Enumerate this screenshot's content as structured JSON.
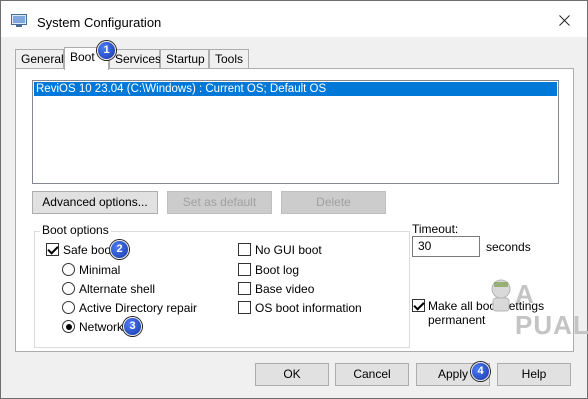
{
  "window": {
    "title": "System Configuration",
    "close_glyph": "✕"
  },
  "tabs": [
    {
      "label": "General",
      "active": false
    },
    {
      "label": "Boot",
      "active": true
    },
    {
      "label": "Services",
      "active": false
    },
    {
      "label": "Startup",
      "active": false
    },
    {
      "label": "Tools",
      "active": false
    }
  ],
  "os_list": {
    "entries": [
      "ReviOS 10 23.04 (C:\\Windows) : Current OS; Default OS"
    ],
    "selected_index": 0
  },
  "os_buttons": {
    "advanced": "Advanced options...",
    "set_default": "Set as default",
    "delete": "Delete"
  },
  "boot_options": {
    "label": "Boot options",
    "safe_boot": {
      "label": "Safe boot",
      "checked": true
    },
    "modes": [
      {
        "label": "Minimal",
        "selected": false
      },
      {
        "label": "Alternate shell",
        "selected": false
      },
      {
        "label": "Active Directory repair",
        "selected": false
      },
      {
        "label": "Network",
        "selected": true
      }
    ],
    "flags": [
      {
        "label": "No GUI boot",
        "checked": false
      },
      {
        "label": "Boot log",
        "checked": false
      },
      {
        "label": "Base video",
        "checked": false
      },
      {
        "label": "OS boot information",
        "checked": false
      }
    ]
  },
  "timeout": {
    "label": "Timeout:",
    "value": "30",
    "unit": "seconds"
  },
  "make_permanent": {
    "label_line1": "Make all boot settings",
    "label_line2": "permanent",
    "checked": true
  },
  "footer": {
    "ok": "OK",
    "cancel": "Cancel",
    "apply": "Apply",
    "help": "Help"
  },
  "annotations": [
    "1",
    "2",
    "3",
    "4"
  ],
  "watermark": {
    "text": "A PUALS"
  },
  "colors": {
    "selection": "#0078d7",
    "badge": "#1f4fd6",
    "panel": "#ffffff",
    "chrome": "#f0f0f0"
  }
}
